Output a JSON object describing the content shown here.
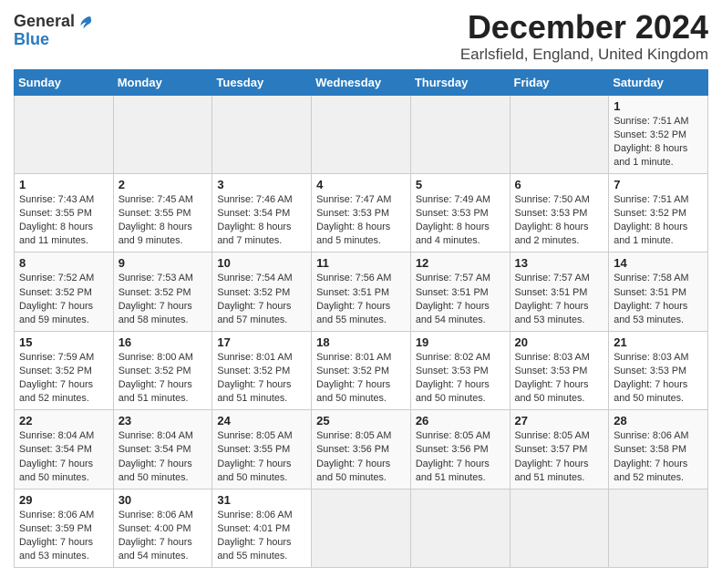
{
  "logo": {
    "general": "General",
    "blue": "Blue"
  },
  "title": "December 2024",
  "subtitle": "Earlsfield, England, United Kingdom",
  "calendar": {
    "headers": [
      "Sunday",
      "Monday",
      "Tuesday",
      "Wednesday",
      "Thursday",
      "Friday",
      "Saturday"
    ],
    "weeks": [
      [
        null,
        null,
        null,
        null,
        null,
        null,
        {
          "num": "1",
          "sunrise": "Sunrise: 7:51 AM",
          "sunset": "Sunset: 3:52 PM",
          "daylight": "Daylight: 8 hours and 1 minute."
        }
      ],
      [
        {
          "num": "1",
          "sunrise": "Sunrise: 7:43 AM",
          "sunset": "Sunset: 3:55 PM",
          "daylight": "Daylight: 8 hours and 11 minutes."
        },
        {
          "num": "2",
          "sunrise": "Sunrise: 7:45 AM",
          "sunset": "Sunset: 3:55 PM",
          "daylight": "Daylight: 8 hours and 9 minutes."
        },
        {
          "num": "3",
          "sunrise": "Sunrise: 7:46 AM",
          "sunset": "Sunset: 3:54 PM",
          "daylight": "Daylight: 8 hours and 7 minutes."
        },
        {
          "num": "4",
          "sunrise": "Sunrise: 7:47 AM",
          "sunset": "Sunset: 3:53 PM",
          "daylight": "Daylight: 8 hours and 5 minutes."
        },
        {
          "num": "5",
          "sunrise": "Sunrise: 7:49 AM",
          "sunset": "Sunset: 3:53 PM",
          "daylight": "Daylight: 8 hours and 4 minutes."
        },
        {
          "num": "6",
          "sunrise": "Sunrise: 7:50 AM",
          "sunset": "Sunset: 3:53 PM",
          "daylight": "Daylight: 8 hours and 2 minutes."
        },
        {
          "num": "7",
          "sunrise": "Sunrise: 7:51 AM",
          "sunset": "Sunset: 3:52 PM",
          "daylight": "Daylight: 8 hours and 1 minute."
        }
      ],
      [
        {
          "num": "8",
          "sunrise": "Sunrise: 7:52 AM",
          "sunset": "Sunset: 3:52 PM",
          "daylight": "Daylight: 7 hours and 59 minutes."
        },
        {
          "num": "9",
          "sunrise": "Sunrise: 7:53 AM",
          "sunset": "Sunset: 3:52 PM",
          "daylight": "Daylight: 7 hours and 58 minutes."
        },
        {
          "num": "10",
          "sunrise": "Sunrise: 7:54 AM",
          "sunset": "Sunset: 3:52 PM",
          "daylight": "Daylight: 7 hours and 57 minutes."
        },
        {
          "num": "11",
          "sunrise": "Sunrise: 7:56 AM",
          "sunset": "Sunset: 3:51 PM",
          "daylight": "Daylight: 7 hours and 55 minutes."
        },
        {
          "num": "12",
          "sunrise": "Sunrise: 7:57 AM",
          "sunset": "Sunset: 3:51 PM",
          "daylight": "Daylight: 7 hours and 54 minutes."
        },
        {
          "num": "13",
          "sunrise": "Sunrise: 7:57 AM",
          "sunset": "Sunset: 3:51 PM",
          "daylight": "Daylight: 7 hours and 53 minutes."
        },
        {
          "num": "14",
          "sunrise": "Sunrise: 7:58 AM",
          "sunset": "Sunset: 3:51 PM",
          "daylight": "Daylight: 7 hours and 53 minutes."
        }
      ],
      [
        {
          "num": "15",
          "sunrise": "Sunrise: 7:59 AM",
          "sunset": "Sunset: 3:52 PM",
          "daylight": "Daylight: 7 hours and 52 minutes."
        },
        {
          "num": "16",
          "sunrise": "Sunrise: 8:00 AM",
          "sunset": "Sunset: 3:52 PM",
          "daylight": "Daylight: 7 hours and 51 minutes."
        },
        {
          "num": "17",
          "sunrise": "Sunrise: 8:01 AM",
          "sunset": "Sunset: 3:52 PM",
          "daylight": "Daylight: 7 hours and 51 minutes."
        },
        {
          "num": "18",
          "sunrise": "Sunrise: 8:01 AM",
          "sunset": "Sunset: 3:52 PM",
          "daylight": "Daylight: 7 hours and 50 minutes."
        },
        {
          "num": "19",
          "sunrise": "Sunrise: 8:02 AM",
          "sunset": "Sunset: 3:53 PM",
          "daylight": "Daylight: 7 hours and 50 minutes."
        },
        {
          "num": "20",
          "sunrise": "Sunrise: 8:03 AM",
          "sunset": "Sunset: 3:53 PM",
          "daylight": "Daylight: 7 hours and 50 minutes."
        },
        {
          "num": "21",
          "sunrise": "Sunrise: 8:03 AM",
          "sunset": "Sunset: 3:53 PM",
          "daylight": "Daylight: 7 hours and 50 minutes."
        }
      ],
      [
        {
          "num": "22",
          "sunrise": "Sunrise: 8:04 AM",
          "sunset": "Sunset: 3:54 PM",
          "daylight": "Daylight: 7 hours and 50 minutes."
        },
        {
          "num": "23",
          "sunrise": "Sunrise: 8:04 AM",
          "sunset": "Sunset: 3:54 PM",
          "daylight": "Daylight: 7 hours and 50 minutes."
        },
        {
          "num": "24",
          "sunrise": "Sunrise: 8:05 AM",
          "sunset": "Sunset: 3:55 PM",
          "daylight": "Daylight: 7 hours and 50 minutes."
        },
        {
          "num": "25",
          "sunrise": "Sunrise: 8:05 AM",
          "sunset": "Sunset: 3:56 PM",
          "daylight": "Daylight: 7 hours and 50 minutes."
        },
        {
          "num": "26",
          "sunrise": "Sunrise: 8:05 AM",
          "sunset": "Sunset: 3:56 PM",
          "daylight": "Daylight: 7 hours and 51 minutes."
        },
        {
          "num": "27",
          "sunrise": "Sunrise: 8:05 AM",
          "sunset": "Sunset: 3:57 PM",
          "daylight": "Daylight: 7 hours and 51 minutes."
        },
        {
          "num": "28",
          "sunrise": "Sunrise: 8:06 AM",
          "sunset": "Sunset: 3:58 PM",
          "daylight": "Daylight: 7 hours and 52 minutes."
        }
      ],
      [
        {
          "num": "29",
          "sunrise": "Sunrise: 8:06 AM",
          "sunset": "Sunset: 3:59 PM",
          "daylight": "Daylight: 7 hours and 53 minutes."
        },
        {
          "num": "30",
          "sunrise": "Sunrise: 8:06 AM",
          "sunset": "Sunset: 4:00 PM",
          "daylight": "Daylight: 7 hours and 54 minutes."
        },
        {
          "num": "31",
          "sunrise": "Sunrise: 8:06 AM",
          "sunset": "Sunset: 4:01 PM",
          "daylight": "Daylight: 7 hours and 55 minutes."
        },
        null,
        null,
        null,
        null
      ]
    ]
  }
}
